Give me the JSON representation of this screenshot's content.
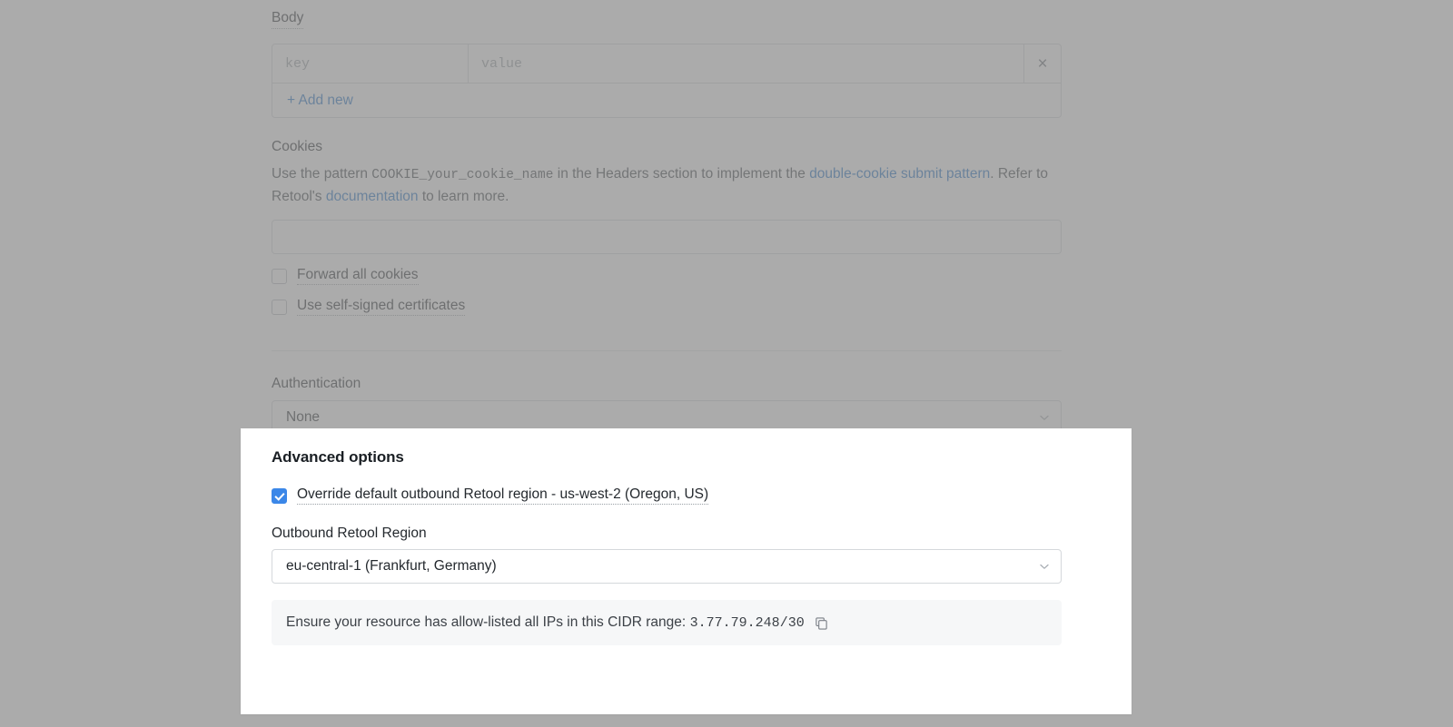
{
  "colors": {
    "accent_blue": "#1f6fc4",
    "checkbox_blue": "#3b87e8",
    "overlay_gray": "#8a8a8a",
    "info_box_bg": "#f6f7f8",
    "border": "#d5d8dc",
    "text": "#24292e"
  },
  "form": {
    "body_section": {
      "label": "Body",
      "key_placeholder": "key",
      "value_placeholder": "value",
      "remove_icon": "close-icon",
      "remove_glyph": "×",
      "add_new_label": "+ Add new"
    },
    "cookies_section": {
      "label": "Cookies",
      "description_part1": "Use the pattern",
      "description_code": "COOKIE_your_cookie_name",
      "description_part2": "in the Headers section to implement the",
      "description_link1": "double-cookie submit pattern",
      "description_part3": ".",
      "description_part4": "Refer to Retool's",
      "description_link2": "documentation",
      "description_part5": "to learn more.",
      "cookies_input_value": "",
      "forward_all_cookies": {
        "label": "Forward all cookies",
        "checked": false
      },
      "use_self_signed_certificates": {
        "label": "Use self-signed certificates",
        "checked": false
      }
    },
    "authentication_section": {
      "label": "Authentication",
      "selected": "None",
      "chevron_icon": "chevron-down-icon"
    }
  },
  "modal": {
    "title": "Advanced options",
    "override_region": {
      "label": "Override default outbound Retool region - us-west-2 (Oregon, US)",
      "checked": true
    },
    "outbound_region": {
      "label": "Outbound Retool Region",
      "selected": "eu-central-1 (Frankfurt, Germany)",
      "chevron_icon": "chevron-down-icon"
    },
    "cidr_notice": {
      "text": "Ensure your resource has allow-listed all IPs in this CIDR range:",
      "cidr": "3.77.79.248/30",
      "copy_icon": "copy-icon"
    }
  }
}
